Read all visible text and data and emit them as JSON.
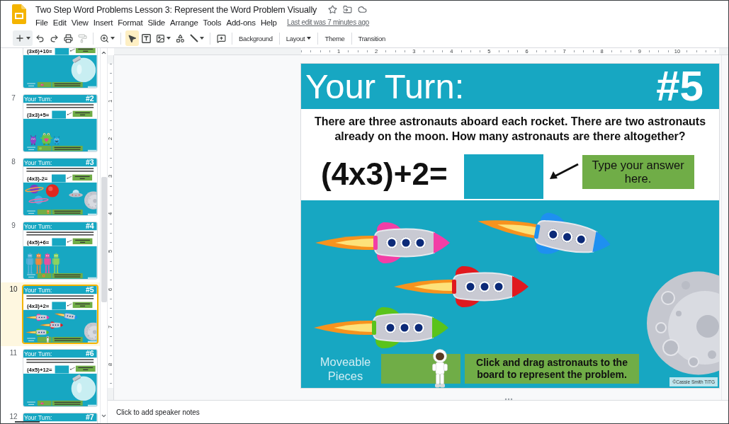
{
  "header": {
    "title": "Two Step Word Problems Lesson 3: Represent the Word Problem Visually",
    "menu": [
      "File",
      "Edit",
      "View",
      "Insert",
      "Format",
      "Slide",
      "Arrange",
      "Tools",
      "Add-ons",
      "Help"
    ],
    "last_edit": "Last edit was 7 minutes ago"
  },
  "toolbar": {
    "groups": [
      [
        {
          "kind": "new-slide",
          "dropdown": true,
          "disabled": false
        },
        {
          "kind": "undo",
          "dropdown": false,
          "disabled": false
        },
        {
          "kind": "redo",
          "dropdown": false,
          "disabled": false
        },
        {
          "kind": "print",
          "dropdown": false,
          "disabled": false
        },
        {
          "kind": "paint-format",
          "dropdown": false,
          "disabled": true
        }
      ],
      [
        {
          "kind": "zoom",
          "dropdown": true,
          "disabled": false
        }
      ],
      [
        {
          "kind": "select",
          "dropdown": false,
          "selected": true
        },
        {
          "kind": "text",
          "dropdown": false,
          "selected": false
        },
        {
          "kind": "image",
          "dropdown": true,
          "selected": false
        },
        {
          "kind": "shape",
          "dropdown": false,
          "selected": false
        },
        {
          "kind": "line",
          "dropdown": true,
          "selected": false
        }
      ],
      [
        {
          "kind": "comment",
          "dropdown": false,
          "disabled": false
        }
      ]
    ],
    "buttons": [
      {
        "label": "Background",
        "dropdown": false
      },
      {
        "label": "Layout",
        "dropdown": true
      },
      {
        "label": "Theme",
        "dropdown": false
      },
      {
        "label": "Transition",
        "dropdown": false
      }
    ]
  },
  "slides": [
    {
      "equation": "(3x6)+10=",
      "kind": "candies",
      "selected": false
    },
    {
      "number": "7",
      "title": "Your Turn:",
      "badge": "#2",
      "equation": "(3x3)+5=",
      "kind": "monsters",
      "selected": false
    },
    {
      "number": "8",
      "title": "Your Turn:",
      "badge": "#3",
      "equation": "(4x3)-2=",
      "kind": "planets",
      "selected": false
    },
    {
      "number": "9",
      "title": "Your Turn:",
      "badge": "#4",
      "equation": "(4x5)+6=",
      "kind": "robots",
      "selected": false
    },
    {
      "number": "10",
      "title": "Your Turn:",
      "badge": "#5",
      "equation": "(4x3)+2=",
      "kind": "rockets",
      "selected": true
    },
    {
      "number": "11",
      "title": "Your Turn:",
      "badge": "#6",
      "equation": "(4x5)+12=",
      "kind": "candies",
      "selected": false
    },
    {
      "number": "12",
      "title": "Your Turn:",
      "badge": "#7",
      "selected": false
    }
  ],
  "rulers": {
    "horizontal": [
      "1",
      "2",
      "3",
      "4",
      "5",
      "6",
      "7",
      "8",
      "9",
      "10"
    ],
    "vertical": [
      "1",
      "2",
      "3",
      "4",
      "5",
      "6",
      "7",
      "8"
    ]
  },
  "slide": {
    "title": "Your Turn:",
    "badge": "#5",
    "question": "There are three astronauts aboard each rocket. There are two astronauts already on the moon. How many astronauts are there altogether?",
    "equation": "(4x3)+2=",
    "answer_hint": "Type your answer here.",
    "pieces_label": "Moveable Pieces",
    "instruction": "Click and drag astronauts to the board to represent the problem.",
    "copyright": "©Cassie Smith TITG",
    "kind": "rockets"
  },
  "notes": {
    "placeholder": "Click to add speaker notes"
  }
}
